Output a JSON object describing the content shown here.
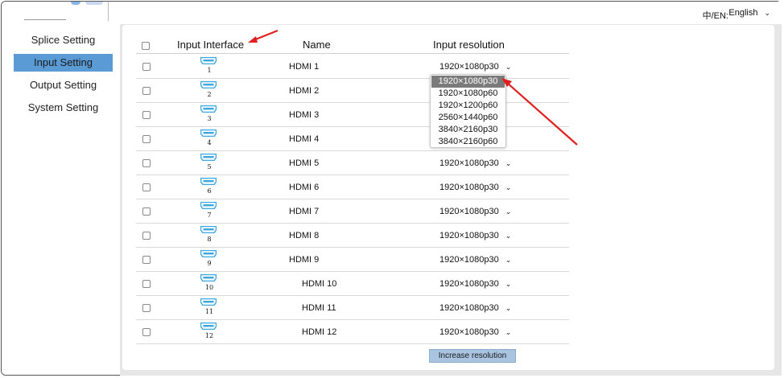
{
  "sidebar": {
    "items": [
      {
        "label": "Splice Setting",
        "active": false
      },
      {
        "label": "Input Setting",
        "active": true
      },
      {
        "label": "Output Setting",
        "active": false
      },
      {
        "label": "System Setting",
        "active": false
      }
    ]
  },
  "topbar": {
    "lang_label": "中/EN:",
    "lang_value": "English"
  },
  "table": {
    "headers": {
      "interface": "Input Interface",
      "name": "Name",
      "resolution": "Input resolution"
    },
    "rows": [
      {
        "port": "1",
        "name": "HDMI 1",
        "resolution": "1920×1080p30"
      },
      {
        "port": "2",
        "name": "HDMI 2",
        "resolution": "1920×1080p30"
      },
      {
        "port": "3",
        "name": "HDMI 3",
        "resolution": "1920×1080p30"
      },
      {
        "port": "4",
        "name": "HDMI 4",
        "resolution": "1920×1080p30"
      },
      {
        "port": "5",
        "name": "HDMI 5",
        "resolution": "1920×1080p30"
      },
      {
        "port": "6",
        "name": "HDMI 6",
        "resolution": "1920×1080p30"
      },
      {
        "port": "7",
        "name": "HDMI 7",
        "resolution": "1920×1080p30"
      },
      {
        "port": "8",
        "name": "HDMI 8",
        "resolution": "1920×1080p30"
      },
      {
        "port": "9",
        "name": "HDMI 9",
        "resolution": "1920×1080p30"
      },
      {
        "port": "10",
        "name": "HDMI 10",
        "resolution": "1920×1080p30"
      },
      {
        "port": "11",
        "name": "HDMI 11",
        "resolution": "1920×1080p30"
      },
      {
        "port": "12",
        "name": "HDMI 12",
        "resolution": "1920×1080p30"
      }
    ]
  },
  "dropdown": {
    "options": [
      "1920×1080p30",
      "1920×1080p60",
      "1920×1200p60",
      "2560×1440p60",
      "3840×2160p30",
      "3840×2160p60"
    ],
    "selected_index": 0
  },
  "buttons": {
    "increase_resolution": "Increase resolution"
  },
  "icons": {
    "port": "hdmi-port-icon",
    "chevron": "chevron-down-icon"
  },
  "colors": {
    "accent": "#5b9bd5",
    "button": "#a8c4e0",
    "hdmi_icon": "#3aa7e0",
    "annotation_arrow": "#e02020",
    "dropdown_selected": "#7b7b7b"
  }
}
